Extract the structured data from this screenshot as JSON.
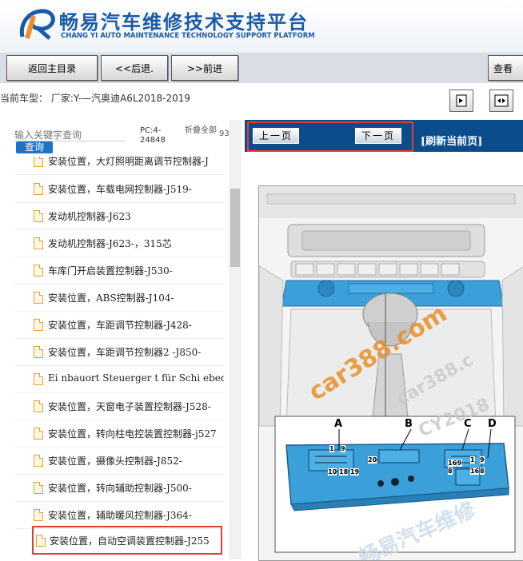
{
  "header": {
    "title": "畅易汽车维修技术支持平台",
    "subtitle": "CHANG YI AUTO MAINTENANCE TECHNOLOGY SUPPORT PLATFORM"
  },
  "nav": {
    "home": "返回主目录",
    "back": "<<后退.",
    "forward": ">>前进",
    "view": "查看"
  },
  "car": {
    "label": "当前车型： 厂家:Y-—汽奥迪A6L2018-2019"
  },
  "sidebar": {
    "search_placeholder": "输入关键字查询",
    "search_button": "查询",
    "pc_code": "PC:4-24848",
    "collapse_all": "折叠全部",
    "extra_label": "93",
    "items": [
      {
        "label": "安装位置，大灯照明距离调节控制器-J"
      },
      {
        "label": "安装位置，车载电网控制器-J519-"
      },
      {
        "label": "发动机控制器-J623"
      },
      {
        "label": "发动机控制器-J623-，315芯"
      },
      {
        "label": "车库门开启装置控制器-J530-"
      },
      {
        "label": "安装位置，ABS控制器-J104-"
      },
      {
        "label": "安装位置，车距调节控制器-J428-"
      },
      {
        "label": "安装位置，车距调节控制器2 -J850-"
      },
      {
        "label": "Ei nbauort Steuerger t für Schi ebedach -J"
      },
      {
        "label": "安装位置，天窗电子装置控制器-J528-"
      },
      {
        "label": "安装位置，转向柱电控装置控制器-j527"
      },
      {
        "label": "安装位置，摄像头控制器-J852-"
      },
      {
        "label": "安装位置，转向辅助控制器-J500-"
      },
      {
        "label": "安装位置，辅助暖风控制器-J364-"
      },
      {
        "label": "安装位置，自动空调装置控制器-J255"
      }
    ]
  },
  "doc": {
    "prev_page": "上一页",
    "next_page": "下一页",
    "refresh": "[刷新当前页]",
    "callouts": {
      "a": "A",
      "b": "B",
      "c": "C",
      "d": "D"
    },
    "pins": [
      "1",
      "9",
      "10",
      "18",
      "19",
      "20",
      "16",
      "8",
      "1",
      "9",
      "16",
      "8",
      "9"
    ],
    "watermark1": "car388.com",
    "watermark2": "car388.c",
    "watermark3": "CY2018",
    "watermark4": "畅易汽车维修"
  },
  "colors": {
    "brand_blue": "#1a5aa8",
    "toolbar_blue": "#0b4d8c",
    "highlight_red": "#e23b3b",
    "part_blue": "#3ba0d9",
    "watermark_orange": "#e8902a"
  }
}
